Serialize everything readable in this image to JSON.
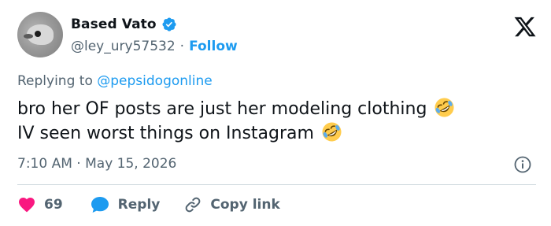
{
  "author": {
    "display_name": "Based Vato",
    "handle": "@ley_ury57532",
    "separator": "·",
    "follow_label": "Follow"
  },
  "reply_context": {
    "prefix": "Replying to",
    "mention": "@pepsidogonline"
  },
  "tweet": {
    "line1": "bro her OF posts are just her modeling clothing",
    "line2": "IV seen worst things on Instagram",
    "emoji": "rolling-on-floor-laughing"
  },
  "meta": {
    "time": "7:10 AM",
    "separator": "·",
    "date": "May 15, 2026"
  },
  "actions": {
    "like_count": "69",
    "reply_label": "Reply",
    "copy_label": "Copy link"
  },
  "colors": {
    "accent": "#1d9bf0",
    "muted": "#536471",
    "like": "#f91880",
    "text": "#0f1419",
    "divider": "#cfd9de"
  }
}
